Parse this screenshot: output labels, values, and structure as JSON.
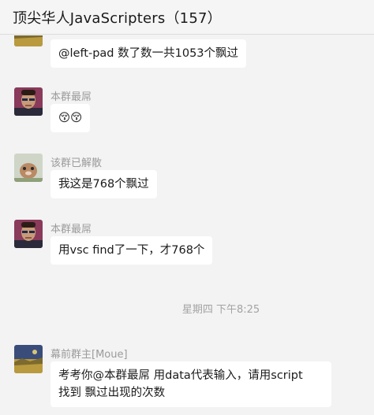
{
  "window": {
    "title": "顶尖华人JavaScripters（157）"
  },
  "messages": [
    {
      "sender": "",
      "text": "@left-pad 数了数一共1053个飘过",
      "avatar": "landscape-avatar"
    },
    {
      "sender": "本群最屌",
      "text": "😚😚",
      "avatar": "person-avatar"
    },
    {
      "sender": "该群已解散",
      "text": "我这是768个飘过",
      "avatar": "cartoon-avatar"
    },
    {
      "sender": "本群最屌",
      "text": "用vsc find了一下，才768个",
      "avatar": "person-avatar"
    },
    {
      "sender": "幕前群主[Moue]",
      "text_line1": "考考你@本群最屌 用data代表输入，请用script",
      "text_line2": "找到 飘过出现的次数",
      "avatar": "landscape-avatar"
    }
  ],
  "timestamp": "星期四 下午8:25",
  "colors": {
    "background": "#f3f3f3",
    "bubble": "#ffffff",
    "sender_text": "#9b9b9b"
  }
}
